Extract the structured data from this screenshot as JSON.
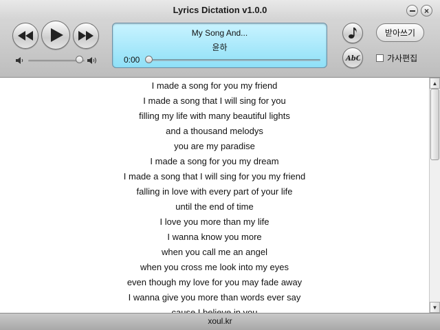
{
  "window": {
    "title": "Lyrics Dictation v1.0.0"
  },
  "player": {
    "song_title": "My Song And...",
    "artist": "윤하",
    "time": "0:00",
    "progress_fraction": 0.0,
    "volume_fraction": 0.9
  },
  "controls": {
    "dictate_label": "받아쓰기",
    "edit_lyrics_label": "가사편집",
    "edit_lyrics_checked": false
  },
  "lyrics": [
    "I made a song for you my friend",
    "I made a song that I will sing for you",
    "filling my life with many beautiful lights",
    "and a thousand melodys",
    "you are my paradise",
    "I made a song for you my dream",
    "I made a song that I will sing for you my friend",
    "falling in love with every part of your life",
    "until the end of time",
    "I love you more than my life",
    "I wanna know you more",
    "when you call me an angel",
    "when you cross me look into my eyes",
    "even though my love for you may fade away",
    "I wanna give you more than words ever say",
    "cause I believe in you"
  ],
  "status": {
    "text": "xoul.kr"
  },
  "icons": {
    "rewind": "rewind-icon",
    "play": "play-icon",
    "fast_forward": "fast-forward-icon",
    "music_note": "music-note-icon",
    "spell_check": "abc-icon",
    "volume_low": "speaker-low-icon",
    "volume_high": "speaker-high-icon"
  },
  "colors": {
    "lcd": "#a8e9fb"
  }
}
